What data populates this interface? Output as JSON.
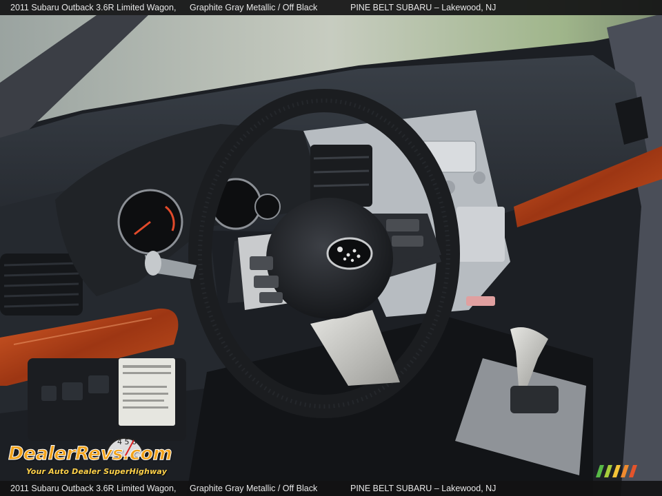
{
  "caption": {
    "vehicle": "2011 Subaru Outback 3.6R Limited Wagon,",
    "colors": "Graphite Gray Metallic / Off Black",
    "dealer": "PINE BELT SUBARU – Lakewood, NJ"
  },
  "watermark": {
    "logo_text": "DealerRevs.com",
    "tagline": "Your Auto Dealer SuperHighway",
    "gauge_digits": "4 5 6"
  },
  "photo": {
    "subject": "car-interior-dashboard",
    "icons": [
      "subaru-logo-icon",
      "steering-wheel-icon",
      "gear-shifter-icon"
    ]
  },
  "colors": {
    "bar_bg": "#121214",
    "bar_text": "#e8e8e8",
    "wood_trim": "#b8441a",
    "dash": "#2b2f35",
    "watermark_orange": "#f2a31b"
  }
}
